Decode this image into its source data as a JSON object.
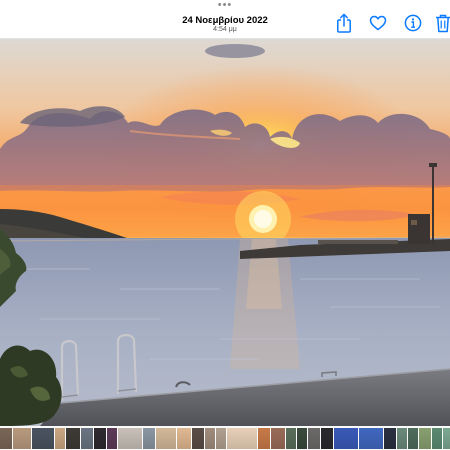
{
  "header": {
    "more_glyph": "•••",
    "date": "24 Νοεμβρίου 2022",
    "time": "4:54 μμ"
  },
  "toolbar": {
    "buttons": [
      {
        "icon": "share-icon"
      },
      {
        "icon": "heart-icon"
      },
      {
        "icon": "info-icon"
      },
      {
        "icon": "trash-icon"
      }
    ],
    "accent_color": "#0a7aff"
  },
  "photo": {
    "subject": "sunset over the sea with harbor pier",
    "sky_colors": [
      "#e8d8c8",
      "#f2b580",
      "#f79a4a",
      "#fbbd52"
    ],
    "sea_color": "#9aa8bc"
  },
  "filmstrip": {
    "thumbnails": [
      {
        "color": "#7a6656"
      },
      {
        "color": "#b89a7e"
      },
      {
        "color": "#4a5460"
      },
      {
        "color": "#caa682"
      },
      {
        "color": "#3e3a36"
      },
      {
        "color": "#6a7482"
      },
      {
        "color": "#2e2a30"
      },
      {
        "color": "#5c3a58"
      },
      {
        "color": "#c8c0b8"
      },
      {
        "color": "#8a96a2"
      },
      {
        "color": "#d2b898"
      },
      {
        "color": "#e0b890"
      },
      {
        "color": "#5a4c46"
      },
      {
        "color": "#a08c7c"
      },
      {
        "color": "#b0a090"
      },
      {
        "color": "#e8d0b8"
      },
      {
        "color": "#c87a48"
      },
      {
        "color": "#9a6c58"
      },
      {
        "color": "#5a6e5a"
      },
      {
        "color": "#3a4a3c"
      },
      {
        "color": "#6c6a68"
      },
      {
        "color": "#2a2a2e"
      },
      {
        "color": "#3a5ab8"
      },
      {
        "color": "#4068c0"
      },
      {
        "color": "#2a3040"
      },
      {
        "color": "#6a8a7a"
      },
      {
        "color": "#4e6c5c"
      },
      {
        "color": "#88a070"
      },
      {
        "color": "#5a8a70"
      },
      {
        "color": "#7ca890"
      },
      {
        "color": "#3a5270"
      },
      {
        "color": "#6e8498"
      },
      {
        "color": "#4b5f72"
      },
      {
        "color": "#2f4256"
      },
      {
        "color": "#8aa0b4"
      }
    ]
  }
}
